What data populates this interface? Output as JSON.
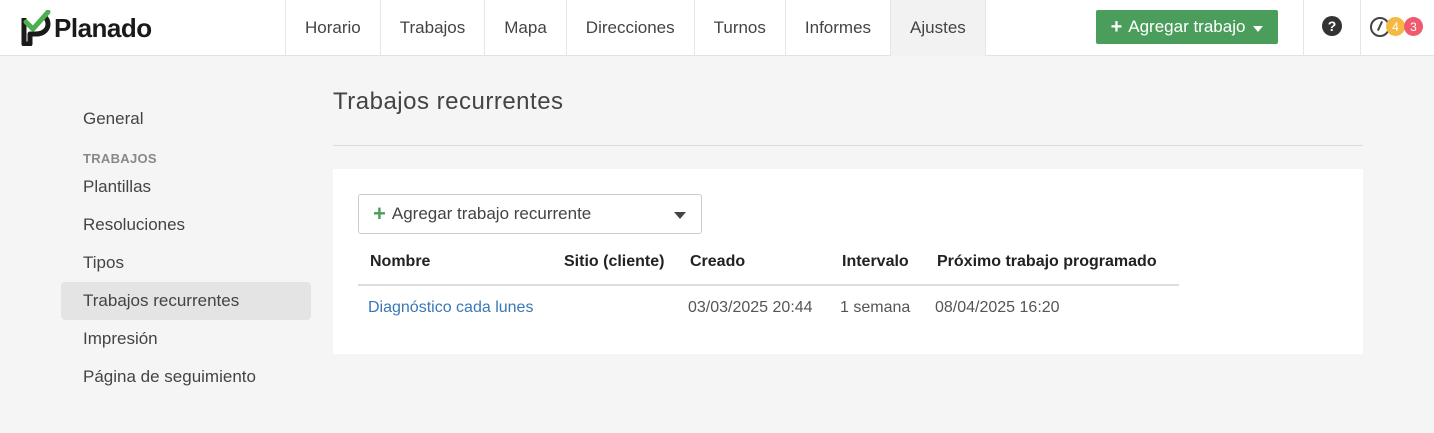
{
  "app": {
    "name": "Planado"
  },
  "nav": {
    "items": [
      {
        "label": "Horario",
        "active": false
      },
      {
        "label": "Trabajos",
        "active": false
      },
      {
        "label": "Mapa",
        "active": false
      },
      {
        "label": "Direcciones",
        "active": false
      },
      {
        "label": "Turnos",
        "active": false
      },
      {
        "label": "Informes",
        "active": false
      },
      {
        "label": "Ajustes",
        "active": true
      }
    ],
    "add_job_label": "Agregar trabajo",
    "help_icon": "question-circle-icon",
    "notif_icon": "gauge-icon",
    "badge_yellow": "4",
    "badge_red": "3"
  },
  "sidebar": {
    "general": "General",
    "section_jobs": "TRABAJOS",
    "items": [
      {
        "label": "Plantillas",
        "active": false
      },
      {
        "label": "Resoluciones",
        "active": false
      },
      {
        "label": "Tipos",
        "active": false
      },
      {
        "label": "Trabajos recurrentes",
        "active": true
      },
      {
        "label": "Impresión",
        "active": false
      },
      {
        "label": "Página de seguimiento",
        "active": false
      }
    ]
  },
  "main": {
    "title": "Trabajos recurrentes",
    "add_recurring_label": "Agregar trabajo recurrente",
    "table": {
      "headers": [
        "Nombre",
        "Sitio (cliente)",
        "Creado",
        "Intervalo",
        "Próximo trabajo programado"
      ],
      "rows": [
        {
          "name": "Diagnóstico cada lunes",
          "site": "",
          "created": "03/03/2025 20:44",
          "interval": "1 semana",
          "next": "08/04/2025 16:20"
        }
      ]
    }
  },
  "colors": {
    "accent_green": "#4a9d5b",
    "link_blue": "#3a78b5",
    "badge_yellow": "#f5b942",
    "badge_red": "#ef5b6e"
  }
}
